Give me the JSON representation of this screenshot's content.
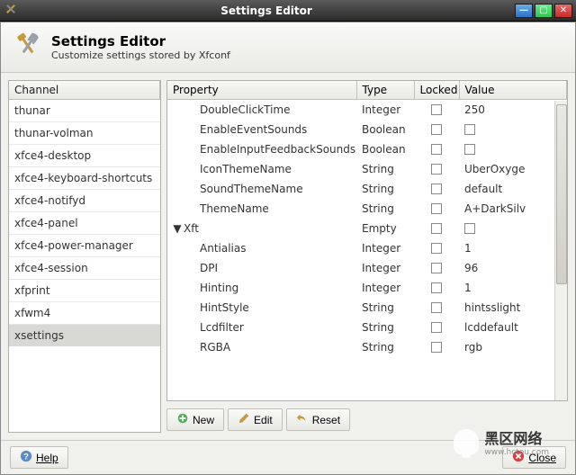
{
  "window": {
    "title": "Settings Editor"
  },
  "header": {
    "title": "Settings Editor",
    "subtitle": "Customize settings stored by Xfconf"
  },
  "channel_header": "Channel",
  "channels": [
    "thunar",
    "thunar-volman",
    "xfce4-desktop",
    "xfce4-keyboard-shortcuts",
    "xfce4-notifyd",
    "xfce4-panel",
    "xfce4-power-manager",
    "xfce4-session",
    "xfprint",
    "xfwm4",
    "xsettings"
  ],
  "channel_selected_index": 10,
  "prop_headers": {
    "property": "Property",
    "type": "Type",
    "locked": "Locked",
    "value": "Value"
  },
  "properties": [
    {
      "name": "DoubleClickTime",
      "type": "Integer",
      "locked": false,
      "value": "250",
      "indent": 1
    },
    {
      "name": "EnableEventSounds",
      "type": "Boolean",
      "locked": false,
      "value": "",
      "indent": 1,
      "value_is_checkbox": true
    },
    {
      "name": "EnableInputFeedbackSounds",
      "type": "Boolean",
      "locked": false,
      "value": "",
      "indent": 1,
      "value_is_checkbox": true
    },
    {
      "name": "IconThemeName",
      "type": "String",
      "locked": false,
      "value": "UberOxyge",
      "indent": 1
    },
    {
      "name": "SoundThemeName",
      "type": "String",
      "locked": false,
      "value": "default",
      "indent": 1
    },
    {
      "name": "ThemeName",
      "type": "String",
      "locked": false,
      "value": "A+DarkSilv",
      "indent": 1
    },
    {
      "name": "Xft",
      "type": "Empty",
      "locked": false,
      "value": "",
      "indent": 0,
      "expanded": true,
      "value_is_checkbox": true
    },
    {
      "name": "Antialias",
      "type": "Integer",
      "locked": false,
      "value": "1",
      "indent": 1
    },
    {
      "name": "DPI",
      "type": "Integer",
      "locked": false,
      "value": "96",
      "indent": 1
    },
    {
      "name": "Hinting",
      "type": "Integer",
      "locked": false,
      "value": "1",
      "indent": 1
    },
    {
      "name": "HintStyle",
      "type": "String",
      "locked": false,
      "value": "hintsslight",
      "indent": 1
    },
    {
      "name": "Lcdfilter",
      "type": "String",
      "locked": false,
      "value": "lcddefault",
      "indent": 1
    },
    {
      "name": "RGBA",
      "type": "String",
      "locked": false,
      "value": "rgb",
      "indent": 1
    }
  ],
  "toolbar": {
    "new_label": "New",
    "edit_label": "Edit",
    "reset_label": "Reset"
  },
  "footer": {
    "help_label": "Help",
    "close_label": "Close"
  },
  "watermark": {
    "text": "黑区网络",
    "sub": "www.hctou.com"
  }
}
